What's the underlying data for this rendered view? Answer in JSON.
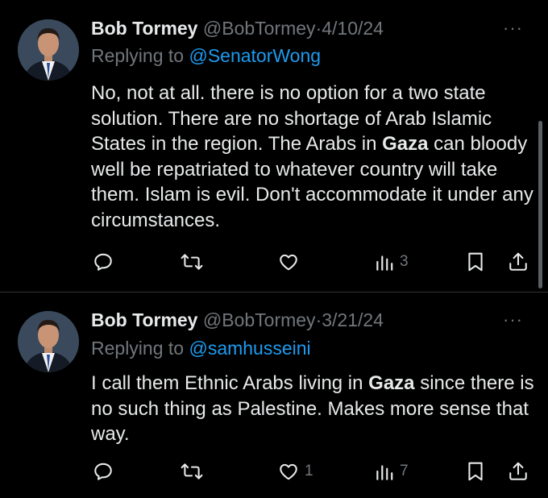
{
  "tweets": [
    {
      "name": "Bob Tormey",
      "handle": "@BobTormey",
      "separator": "·",
      "date": "4/10/24",
      "replying_prefix": "Replying to",
      "replying_to": "@SenatorWong",
      "body": {
        "part1": "No, not at all. there is no option for a two state solution. There are no shortage of Arab Islamic States in the region. The Arabs in ",
        "bold": "Gaza",
        "part2": " can bloody well be repatriated  to whatever country will take them. Islam is evil. Don't accommodate it under any circumstances."
      },
      "likes": "",
      "views": "3"
    },
    {
      "name": "Bob Tormey",
      "handle": "@BobTormey",
      "separator": "·",
      "date": "3/21/24",
      "replying_prefix": "Replying to",
      "replying_to": "@samhusseini",
      "body": {
        "part1": "I call them Ethnic Arabs living in ",
        "bold": "Gaza",
        "part2": " since there is no such thing as Palestine. Makes more sense that way."
      },
      "likes": "1",
      "views": "7"
    }
  ],
  "more_glyph": "···",
  "icons": [
    "reply-icon",
    "retweet-icon",
    "like-icon",
    "views-icon",
    "bookmark-icon",
    "share-icon",
    "more-icon"
  ],
  "colors": {
    "background": "#000000",
    "text": "#e7e9ea",
    "secondary": "#71767b",
    "link": "#1d9bf0",
    "divider": "#2f3336"
  }
}
